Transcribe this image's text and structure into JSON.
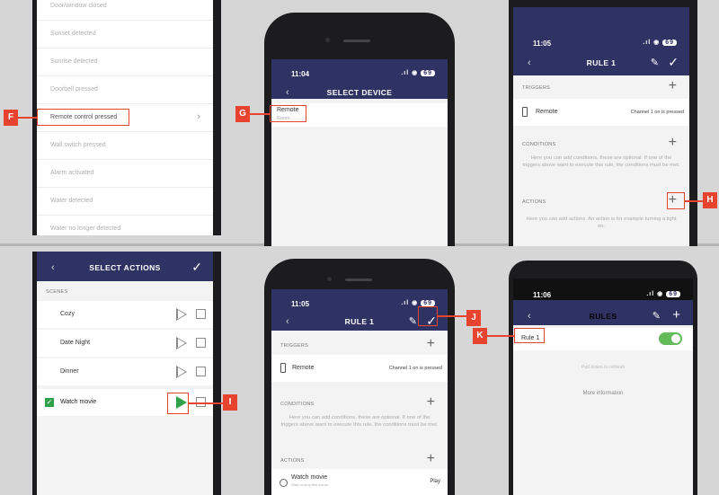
{
  "colors": {
    "navy": "#2f3364",
    "callout": "#e8432f",
    "toggle_on": "#64bb5a",
    "play_green": "#2fa14a"
  },
  "panel_trigger_list": {
    "items": [
      "Door/window closed",
      "Sunset detected",
      "Sunrise detected",
      "Doorbell pressed",
      "Remote control pressed",
      "Wall switch pressed",
      "Alarm activated",
      "Water detected",
      "Water no longer detected"
    ],
    "callout": "F"
  },
  "panel_select_device": {
    "time": "11:04",
    "battery": "69",
    "title": "SELECT DEVICE",
    "device_name": "Remote",
    "device_room": "Room",
    "callout": "G"
  },
  "panel_rule1_a": {
    "time": "11:05",
    "battery": "69",
    "title": "RULE 1",
    "triggers_label": "TRIGGERS",
    "trigger_device": "Remote",
    "trigger_value": "Channel 1 on is pressed",
    "conditions_label": "CONDITIONS",
    "conditions_help": "Here you can add conditions, these are optional. If one of the triggers above want to execute this rule, the conditions must be met.",
    "actions_label": "ACTIONS",
    "actions_help": "Here you can add actions. An action is for example turning a light on.",
    "callout": "H"
  },
  "panel_select_actions": {
    "title": "SELECT ACTIONS",
    "scenes_label": "SCENES",
    "scenes": [
      "Cozy",
      "Date Night",
      "Dinner",
      "Watch movie"
    ],
    "callout": "I"
  },
  "panel_rule1_b": {
    "time": "11:05",
    "battery": "69",
    "title": "RULE 1",
    "triggers_label": "TRIGGERS",
    "trigger_device": "Remote",
    "trigger_value": "Channel 1 on is pressed",
    "conditions_label": "CONDITIONS",
    "conditions_help": "Here you can add conditions, these are optional. If one of the triggers above want to execute this rule, the conditions must be met.",
    "actions_label": "ACTIONS",
    "action_name": "Watch movie",
    "action_sub": "Start or stop this scene",
    "action_value": "Play",
    "callout": "J"
  },
  "panel_rules": {
    "time": "11:06",
    "battery": "69",
    "title": "RULES",
    "rule_name": "Rule 1",
    "pull_text": "Pull down to refresh",
    "more_info": "More information",
    "callout": "K"
  }
}
